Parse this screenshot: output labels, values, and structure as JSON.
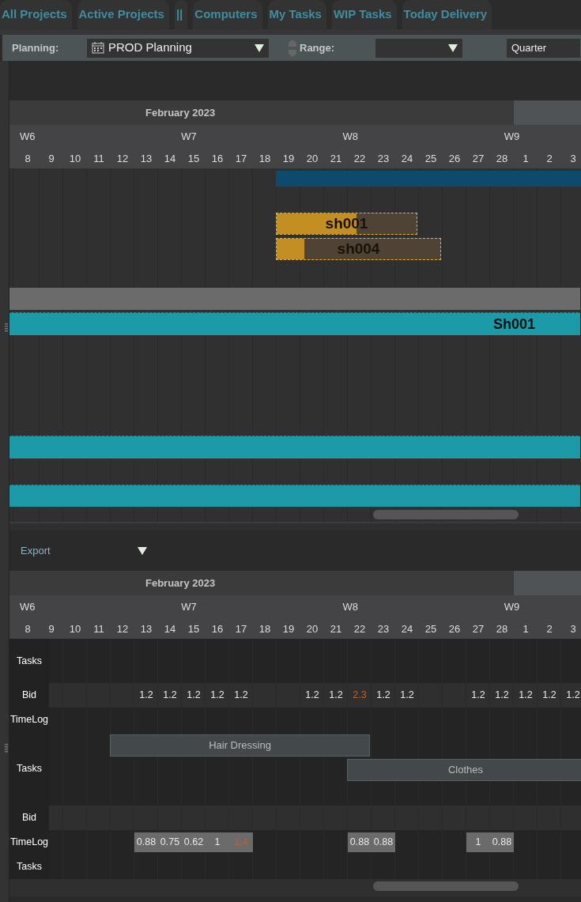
{
  "tabs": [
    {
      "label": "All Projects",
      "selected": false
    },
    {
      "label": "Active Projects",
      "selected": false
    },
    {
      "label": "||",
      "selected": false
    },
    {
      "label": "Computers",
      "selected": false
    },
    {
      "label": "My Tasks",
      "selected": false
    },
    {
      "label": "WIP Tasks",
      "selected": false
    },
    {
      "label": "Today Delivery",
      "selected": false
    }
  ],
  "toolbar": {
    "planning_label": "Planning:",
    "planning_value": "PROD Planning",
    "range_label": "Range:",
    "period_value": "Quarter"
  },
  "planning_chart": {
    "month": "February 2023",
    "weeks": [
      "W6",
      "W7",
      "W8",
      "W9"
    ],
    "days": [
      {
        "label": "8"
      },
      {
        "label": "9"
      },
      {
        "label": "10"
      },
      {
        "label": "11"
      },
      {
        "label": "12"
      },
      {
        "label": "13"
      },
      {
        "label": "14"
      },
      {
        "label": "15"
      },
      {
        "label": "16"
      },
      {
        "label": "17"
      },
      {
        "label": "18"
      },
      {
        "label": "19"
      },
      {
        "label": "20"
      },
      {
        "label": "21"
      },
      {
        "label": "22"
      },
      {
        "label": "23"
      },
      {
        "label": "24"
      },
      {
        "label": "25"
      },
      {
        "label": "26"
      },
      {
        "label": "27"
      },
      {
        "label": "28"
      },
      {
        "label": "1"
      },
      {
        "label": "2"
      },
      {
        "label": "3"
      }
    ],
    "bars": [
      {
        "kind": "band"
      },
      {
        "kind": "shot",
        "label": "sh001",
        "level": 0.57
      },
      {
        "kind": "shot",
        "label": "sh004",
        "level": 0.17
      },
      {
        "kind": "divider"
      },
      {
        "kind": "sequence",
        "label": "Sh001"
      },
      {
        "kind": "sequence"
      },
      {
        "kind": "sequence"
      }
    ]
  },
  "workload": {
    "export_label": "Export",
    "month": "February 2023",
    "weeks": [
      "W6",
      "W7",
      "W8",
      "W9"
    ],
    "days": [
      {
        "label": "8"
      },
      {
        "label": "9"
      },
      {
        "label": "10"
      },
      {
        "label": "11"
      },
      {
        "label": "12"
      },
      {
        "label": "13"
      },
      {
        "label": "14"
      },
      {
        "label": "15"
      },
      {
        "label": "16"
      },
      {
        "label": "17"
      },
      {
        "label": "18"
      },
      {
        "label": "19"
      },
      {
        "label": "20"
      },
      {
        "label": "21"
      },
      {
        "label": "22"
      },
      {
        "label": "23"
      },
      {
        "label": "24"
      },
      {
        "label": "25"
      },
      {
        "label": "26"
      },
      {
        "label": "27"
      },
      {
        "label": "28"
      },
      {
        "label": "1"
      },
      {
        "label": "2"
      },
      {
        "label": "3"
      }
    ],
    "rows": [
      {
        "kind": "tasks",
        "label": "Tasks"
      },
      {
        "kind": "bid",
        "label": "Bid",
        "cells": [
          {
            "value": "1.2",
            "over": false
          },
          {
            "value": "1.2",
            "over": false
          },
          {
            "value": "1.2",
            "over": false
          },
          {
            "value": "1.2",
            "over": false
          },
          {
            "value": "1.2",
            "over": false
          },
          {
            "value": "1.2",
            "over": false
          },
          {
            "value": "1.2",
            "over": false
          },
          {
            "value": "2.3",
            "over": true
          },
          {
            "value": "1.2",
            "over": false
          },
          {
            "value": "1.2",
            "over": false
          },
          {
            "value": "1.2",
            "over": false
          },
          {
            "value": "1.2",
            "over": false
          },
          {
            "value": "1.2",
            "over": false
          },
          {
            "value": "1.2",
            "over": false
          },
          {
            "value": "1.2",
            "over": false
          }
        ]
      },
      {
        "kind": "timelog",
        "label": "TimeLog"
      },
      {
        "kind": "tasks",
        "label": "Tasks",
        "tasks": [
          {
            "label": "Hair Dressing"
          },
          {
            "label": "Clothes"
          }
        ]
      },
      {
        "kind": "bid",
        "label": "Bid"
      },
      {
        "kind": "timelog",
        "label": "TimeLog",
        "cells": [
          {
            "value": "0.88",
            "over": false
          },
          {
            "value": "0.75",
            "over": false
          },
          {
            "value": "0.62",
            "over": false
          },
          {
            "value": "1",
            "over": false
          },
          {
            "value": "1.4",
            "over": true
          },
          {
            "value": "0.88",
            "over": false
          },
          {
            "value": "0.88",
            "over": false
          },
          {
            "value": "1",
            "over": false
          },
          {
            "value": "0.88",
            "over": false
          }
        ]
      },
      {
        "kind": "tasks",
        "label": "Tasks"
      }
    ]
  }
}
